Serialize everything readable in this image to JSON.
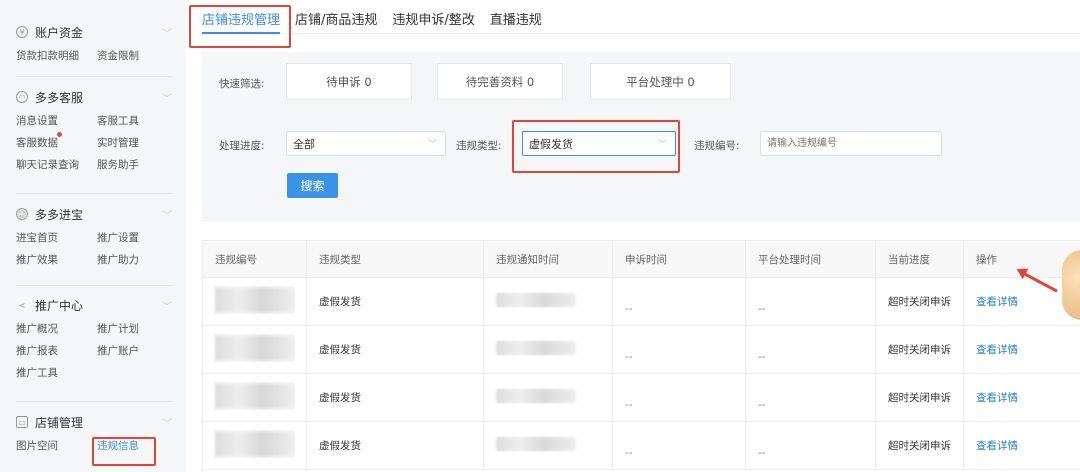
{
  "sidebar": {
    "sections": [
      {
        "title": "账户资金",
        "icon": "wallet-icon",
        "items": [
          "货款扣款明细",
          "资金限制"
        ]
      },
      {
        "title": "多多客服",
        "icon": "headset-icon",
        "items": [
          "消息设置",
          "客服工具",
          "客服数据",
          "实时管理",
          "聊天记录查询",
          "服务助手"
        ]
      },
      {
        "title": "多多进宝",
        "icon": "treasure-icon",
        "items": [
          "进宝首页",
          "推广设置",
          "推广效果",
          "推广助力"
        ]
      },
      {
        "title": "推广中心",
        "icon": "share-icon",
        "items": [
          "推广概况",
          "推广计划",
          "推广报表",
          "推广账户",
          "推广工具"
        ]
      },
      {
        "title": "店铺管理",
        "icon": "store-icon",
        "items": [
          "图片空间",
          "违规信息"
        ]
      }
    ]
  },
  "tabs": [
    "店铺违规管理",
    "店铺/商品违规",
    "违规申诉/整改",
    "直播违规"
  ],
  "filters": {
    "quick_label": "快速筛选:",
    "quick": [
      "待申诉 0",
      "待完善资料 0",
      "平台处理中 0"
    ],
    "progress_label": "处理进度:",
    "progress_value": "全部",
    "type_label": "违规类型:",
    "type_value": "虚假发货",
    "id_label": "违规编号:",
    "id_placeholder": "请输入违规编号",
    "search_label": "搜索"
  },
  "table": {
    "headers": [
      "违规编号",
      "违规类型",
      "违规通知时间",
      "申诉时间",
      "平台处理时间",
      "当前进度",
      "操作"
    ],
    "rows": [
      {
        "type": "虚假发货",
        "appeal": "--",
        "platform": "--",
        "progress": "超时关闭申诉",
        "action": "查看详情"
      },
      {
        "type": "虚假发货",
        "appeal": "--",
        "platform": "--",
        "progress": "超时关闭申诉",
        "action": "查看详情"
      },
      {
        "type": "虚假发货",
        "appeal": "--",
        "platform": "--",
        "progress": "超时关闭申诉",
        "action": "查看详情"
      },
      {
        "type": "虚假发货",
        "appeal": "--",
        "platform": "--",
        "progress": "超时关闭申诉",
        "action": "查看详情"
      }
    ]
  },
  "colors": {
    "accent": "#3a8ee6",
    "annotation": "#e2443a"
  }
}
